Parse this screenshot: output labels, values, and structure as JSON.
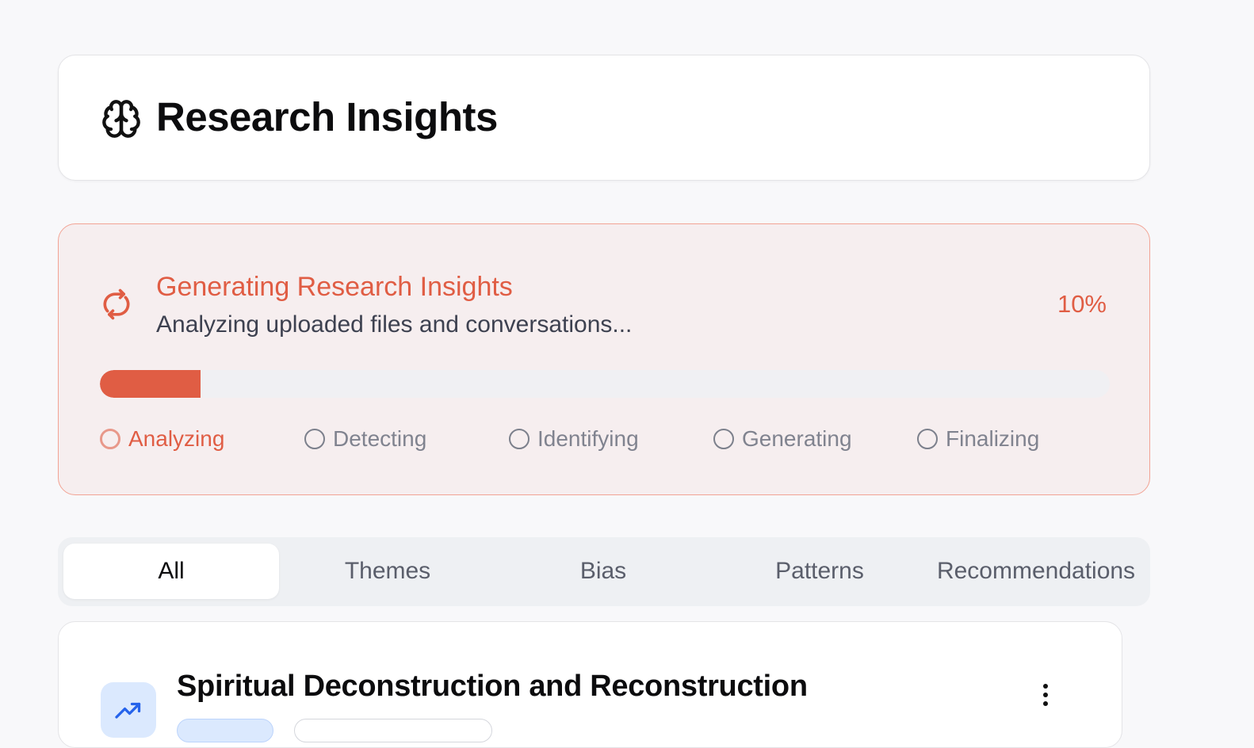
{
  "header": {
    "title": "Research Insights",
    "icon": "brain-icon"
  },
  "progress": {
    "title": "Generating Research Insights",
    "subtitle": "Analyzing uploaded files and conversations...",
    "percent_label": "10%",
    "percent_value": 10,
    "accent_color": "#e05d44",
    "steps": [
      {
        "label": "Analyzing",
        "active": true
      },
      {
        "label": "Detecting",
        "active": false
      },
      {
        "label": "Identifying",
        "active": false
      },
      {
        "label": "Generating",
        "active": false
      },
      {
        "label": "Finalizing",
        "active": false
      }
    ]
  },
  "tabs": [
    {
      "label": "All",
      "active": true
    },
    {
      "label": "Themes",
      "active": false
    },
    {
      "label": "Bias",
      "active": false
    },
    {
      "label": "Patterns",
      "active": false
    },
    {
      "label": "Recommendations",
      "active": false
    }
  ],
  "insight": {
    "title": "Spiritual Deconstruction and Reconstruction",
    "icon": "trending-up-icon",
    "icon_bg": "#dbe9fe"
  }
}
